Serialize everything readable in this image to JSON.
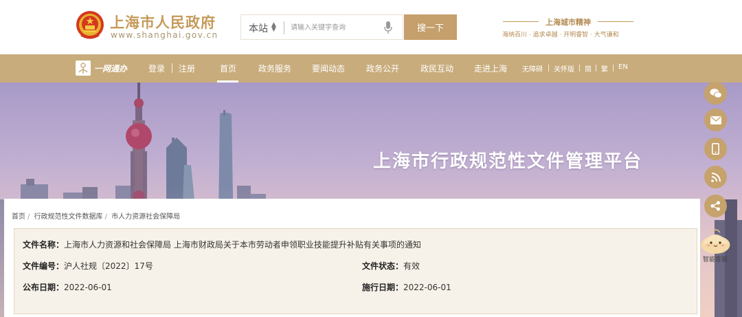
{
  "header": {
    "site_title": "上海市人民政府",
    "site_url": "www.shanghai.gov.cn",
    "search": {
      "scope": "本站",
      "placeholder": "请输入关键字查询",
      "button_label": "搜一下"
    },
    "spirit": {
      "title": "上海城市精神",
      "subtitle": "海纳百川 · 追求卓越 · 开明睿智 · 大气谦和"
    }
  },
  "nav": {
    "logo_text": "一网通办",
    "login": "登录",
    "register": "注册",
    "items": [
      "首页",
      "政务服务",
      "要闻动态",
      "政务公开",
      "政民互动",
      "走进上海"
    ],
    "active_index": 0,
    "tools": [
      "无障碍",
      "关怀版",
      "简",
      "繁",
      "EN"
    ]
  },
  "banner": {
    "title": "上海市行政规范性文件管理平台"
  },
  "floating": {
    "icons": [
      "wechat-icon",
      "mail-icon",
      "mobile-icon",
      "rss-icon",
      "share-icon"
    ],
    "assistant_label": "智能客服"
  },
  "breadcrumb": [
    "首页",
    "行政规范性文件数据库",
    "市人力资源社会保障局"
  ],
  "document": {
    "name_label": "文件名称：",
    "name_value": "上海市人力资源和社会保障局 上海市财政局关于本市劳动者申领职业技能提升补贴有关事项的通知",
    "number_label": "文件编号：",
    "number_value": "沪人社规〔2022〕17号",
    "status_label": "文件状态：",
    "status_value": "有效",
    "publish_label": "公布日期：",
    "publish_value": "2022-06-01",
    "effective_label": "施行日期：",
    "effective_value": "2022-06-01"
  },
  "colors": {
    "brand_gold": "#c59a5a",
    "nav_bg": "#c8ac7c",
    "search_button": "#c59f6c",
    "info_bg": "#f7f2e9"
  }
}
